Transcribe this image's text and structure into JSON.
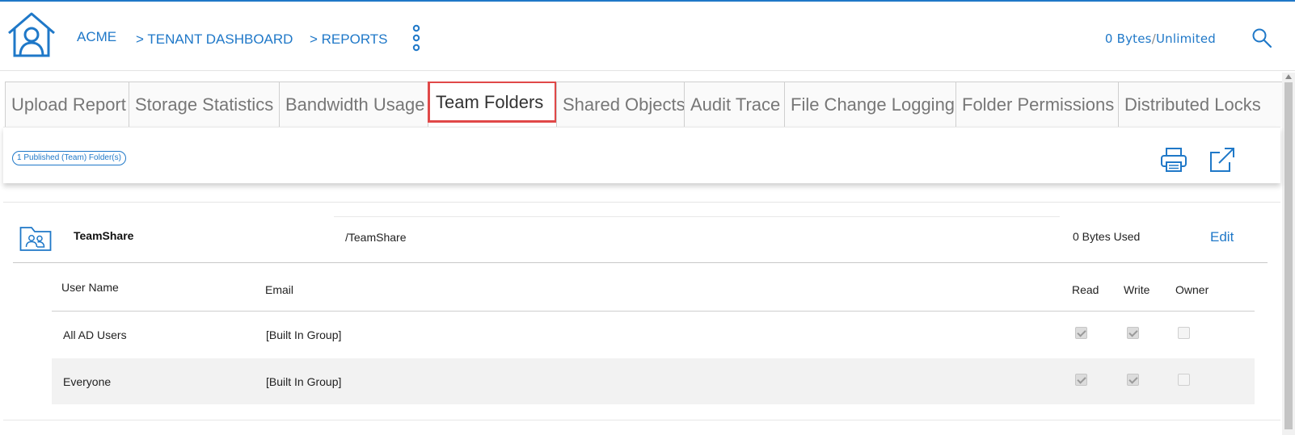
{
  "header": {
    "breadcrumb": {
      "root": "ACME",
      "tenant": "> TENANT DASHBOARD",
      "reports": ">  REPORTS"
    },
    "quota": {
      "used": "0 Bytes",
      "separator": "/",
      "limit": "Unlimited"
    }
  },
  "tabs": [
    {
      "label": "Upload Report",
      "active": false
    },
    {
      "label": "Storage Statistics",
      "active": false
    },
    {
      "label": "Bandwidth Usage",
      "active": false
    },
    {
      "label": "Team Folders",
      "active": true
    },
    {
      "label": "Shared Objects",
      "active": false
    },
    {
      "label": "Audit Trace",
      "active": false
    },
    {
      "label": "File Change Logging",
      "active": false
    },
    {
      "label": "Folder Permissions",
      "active": false
    },
    {
      "label": "Distributed Locks",
      "active": false
    }
  ],
  "toolbar": {
    "badge": "1 Published (Team) Folder(s)"
  },
  "folder": {
    "name": "TeamShare",
    "path": "/TeamShare",
    "used": "0 Bytes Used",
    "edit_label": "Edit"
  },
  "users_table": {
    "headers": {
      "user": "User Name",
      "email": "Email",
      "read": "Read",
      "write": "Write",
      "owner": "Owner"
    },
    "rows": [
      {
        "name": "All AD Users",
        "email": "[Built In Group]",
        "read": true,
        "write": true,
        "owner": false
      },
      {
        "name": "Everyone",
        "email": "[Built In Group]",
        "read": true,
        "write": true,
        "owner": false
      }
    ]
  },
  "colors": {
    "accent": "#1f78c8",
    "active_tab_border": "#e04848"
  }
}
